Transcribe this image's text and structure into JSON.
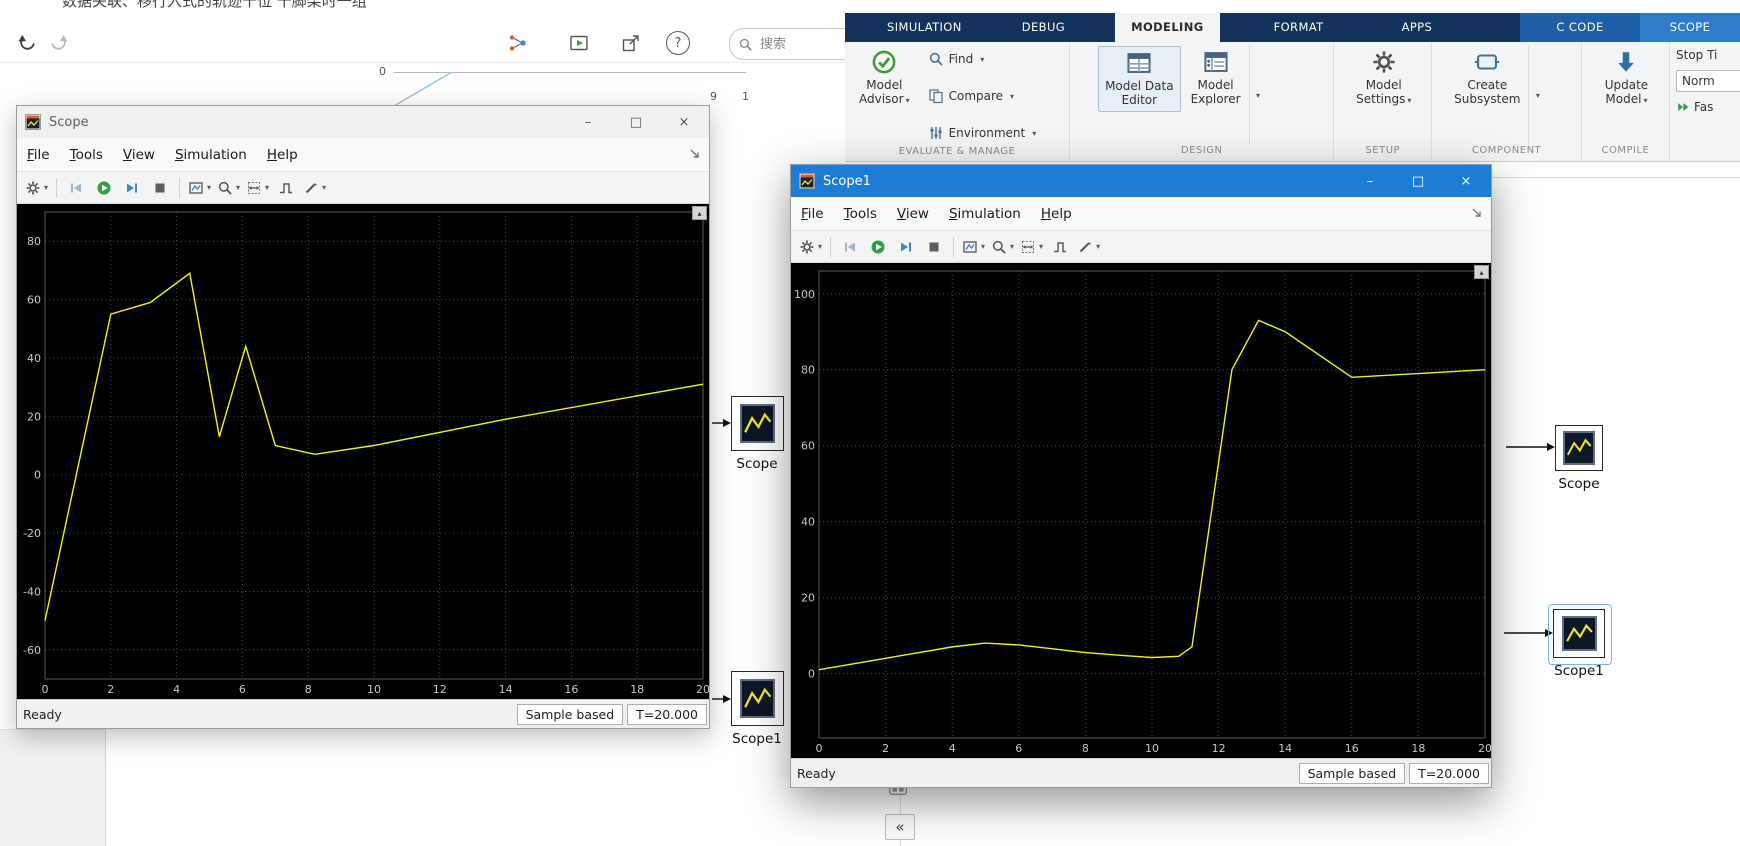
{
  "ui": {
    "caret": "▾",
    "minimize": "–",
    "maximize": "□",
    "close": "×",
    "corner_up": "▴",
    "help": "?"
  },
  "header": {
    "partial_text": "数据关联、移行入式的轨迹十位    十脚架时一组",
    "search_placeholder": "搜索"
  },
  "toolstrip": {
    "tabs": [
      "SIMULATION",
      "DEBUG",
      "MODELING",
      "FORMAT",
      "APPS",
      "C CODE",
      "SCOPE"
    ],
    "groups": [
      {
        "label": "EVALUATE & MANAGE"
      },
      {
        "label": "DESIGN"
      },
      {
        "label": "SETUP"
      },
      {
        "label": "COMPONENT"
      },
      {
        "label": "COMPILE"
      }
    ],
    "model_advisor": {
      "line1": "Model",
      "line2": "Advisor"
    },
    "find": "Find",
    "compare": "Compare",
    "environment": "Environment",
    "model_data_editor": {
      "line1": "Model Data",
      "line2": "Editor"
    },
    "model_explorer": {
      "line1": "Model",
      "line2": "Explorer"
    },
    "model_settings": {
      "line1": "Model",
      "line2": "Settings"
    },
    "create_subsystem": {
      "line1": "Create",
      "line2": "Subsystem"
    },
    "update_model": {
      "line1": "Update",
      "line2": "Model"
    },
    "stop_time_label": "Stop Ti",
    "mode_value": "Norm",
    "fast_restart_label": "Fas"
  },
  "windows": {
    "menus": [
      "File",
      "Tools",
      "View",
      "Simulation",
      "Help"
    ],
    "scope": {
      "title": "Scope",
      "status_ready": "Ready",
      "status_sample": "Sample based",
      "status_time": "T=20.000"
    },
    "scope1": {
      "title": "Scope1",
      "status_ready": "Ready",
      "status_sample": "Sample based",
      "status_time": "T=20.000"
    }
  },
  "canvas": {
    "blocks": [
      {
        "label": "Scope"
      },
      {
        "label": "Scope1"
      },
      {
        "label": "Scope"
      },
      {
        "label": "Scope1",
        "selected": true
      }
    ],
    "collapse_label": "«",
    "fragment_labels": [
      "0",
      "9",
      "1"
    ]
  },
  "chart_data": [
    {
      "id": "scope",
      "type": "line",
      "window_title": "Scope",
      "x": [
        0,
        2,
        3.2,
        4.4,
        5.3,
        6.1,
        7.0,
        8.2,
        10,
        14,
        20
      ],
      "y": [
        -50,
        55,
        59,
        69,
        13,
        44,
        10,
        7,
        10,
        19,
        31
      ],
      "xlim": [
        0,
        20
      ],
      "ylim": [
        -70,
        90
      ],
      "xticks": [
        0,
        2,
        4,
        6,
        8,
        10,
        12,
        14,
        16,
        18,
        20
      ],
      "yticks": [
        -60,
        -40,
        -20,
        0,
        20,
        40,
        60,
        80
      ],
      "xlabel": "",
      "ylabel": "",
      "grid": true,
      "legend": "none",
      "line_color": "#f0ef1f",
      "bg_color": "#000000",
      "grid_color": "#4a4a4a",
      "tick_color": "#c8c8c8"
    },
    {
      "id": "scope1",
      "type": "line",
      "window_title": "Scope1",
      "x": [
        0,
        2,
        4,
        5,
        6,
        8,
        9,
        10,
        10.8,
        11.2,
        12.4,
        13.2,
        14,
        16,
        18,
        20
      ],
      "y": [
        1,
        4,
        7,
        8,
        7.5,
        5.5,
        4.8,
        4.2,
        4.5,
        7,
        80,
        93,
        90,
        78,
        79,
        80
      ],
      "xlim": [
        0,
        20
      ],
      "ylim": [
        -17,
        106
      ],
      "xticks": [
        0,
        2,
        4,
        6,
        8,
        10,
        12,
        14,
        16,
        18,
        20
      ],
      "yticks": [
        0,
        20,
        40,
        60,
        80,
        100
      ],
      "xlabel": "",
      "ylabel": "",
      "grid": true,
      "legend": "none",
      "line_color": "#f0ef1f",
      "bg_color": "#000000",
      "grid_color": "#4a4a4a",
      "tick_color": "#c8c8c8"
    }
  ]
}
